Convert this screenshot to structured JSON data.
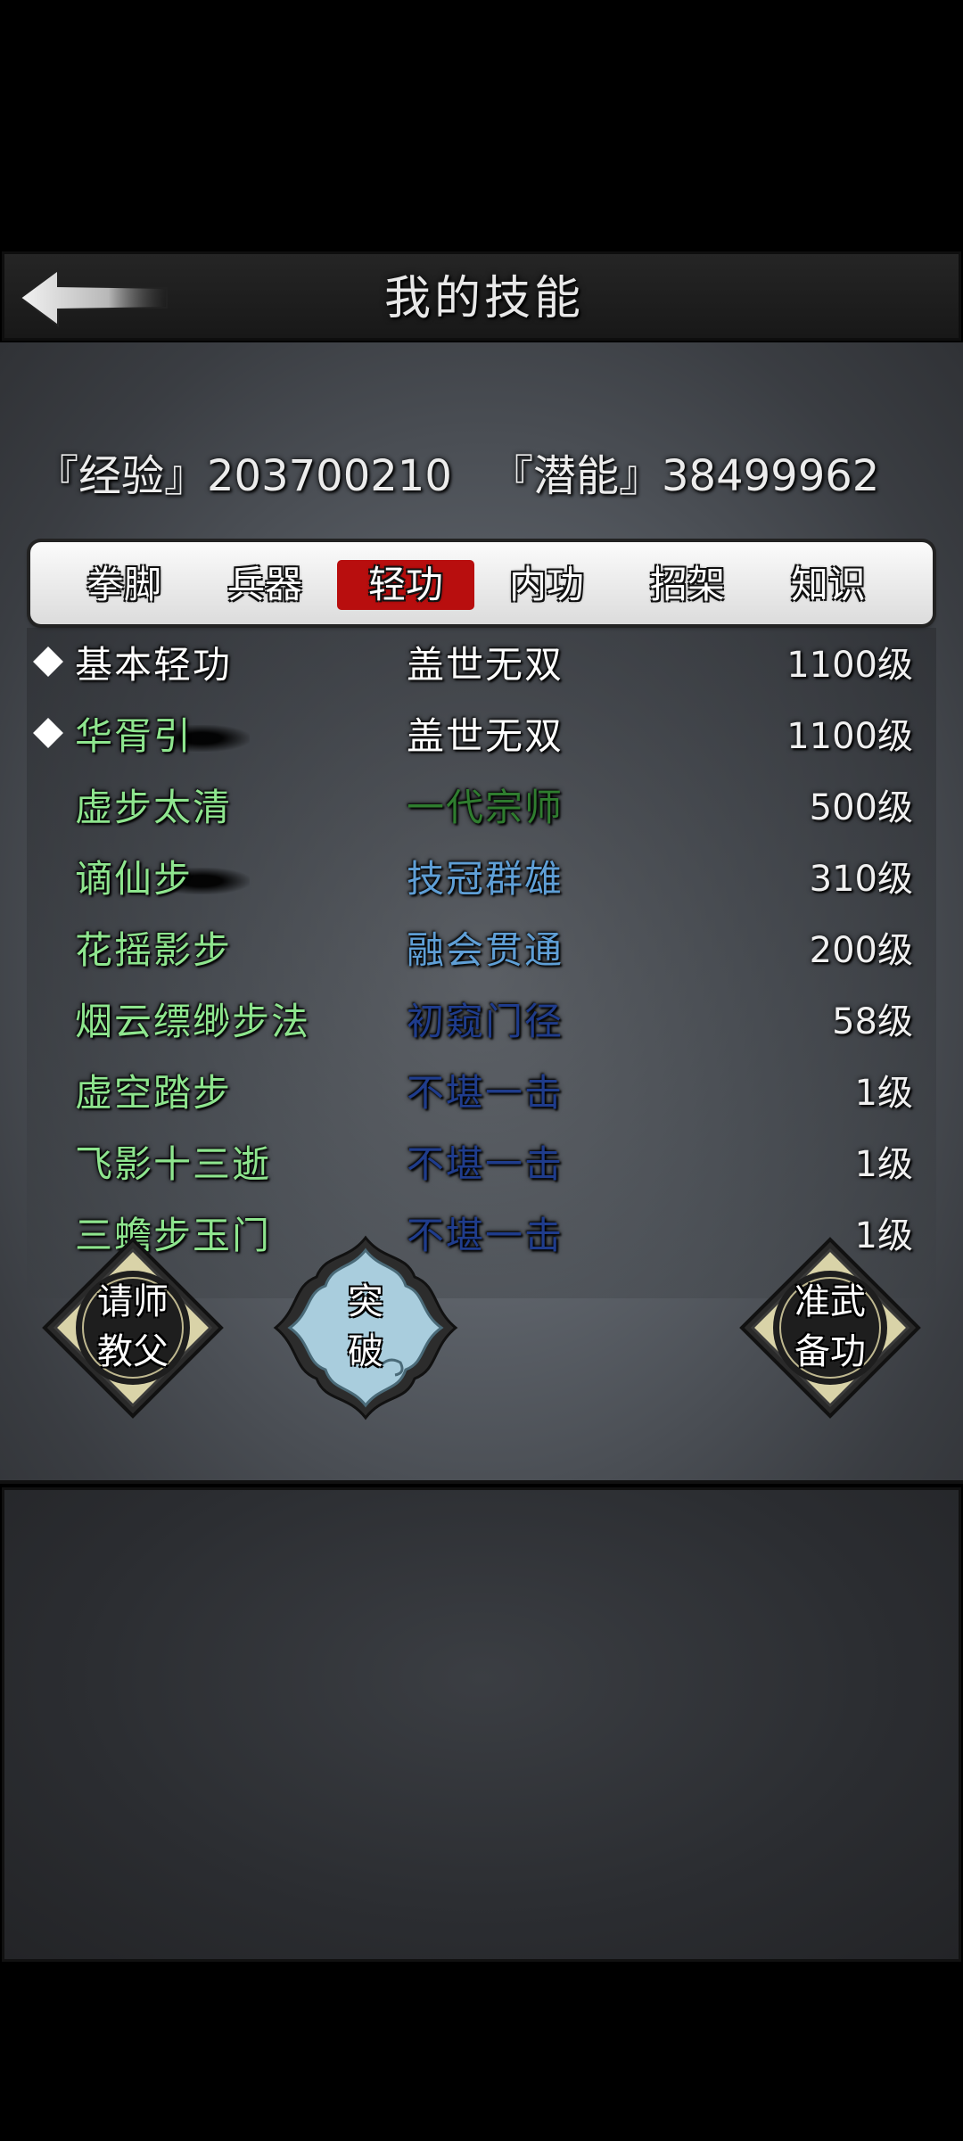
{
  "header": {
    "title": "我的技能"
  },
  "stats": {
    "exp_label": "『经验』",
    "exp_value": "203700210",
    "pot_label": "『潜能』",
    "pot_value": "38499962"
  },
  "tabs": [
    {
      "label": "拳脚",
      "active": false
    },
    {
      "label": "兵器",
      "active": false
    },
    {
      "label": "轻功",
      "active": true
    },
    {
      "label": "内功",
      "active": false
    },
    {
      "label": "招架",
      "active": false
    },
    {
      "label": "知识",
      "active": false
    }
  ],
  "skills": [
    {
      "name": "基本轻功",
      "rank": "盖世无双",
      "level": "1100级",
      "marked": true,
      "name_color": "#ffffff",
      "rank_color": "#ffffff"
    },
    {
      "name": "华胥引",
      "rank": "盖世无双",
      "level": "1100级",
      "marked": true,
      "name_color": "#8ee58e",
      "rank_color": "#ffffff"
    },
    {
      "name": "虚步太清",
      "rank": "一代宗师",
      "level": "500级",
      "marked": false,
      "name_color": "#8ee58e",
      "rank_color": "#2f7d2f"
    },
    {
      "name": "谪仙步",
      "rank": "技冠群雄",
      "level": "310级",
      "marked": false,
      "name_color": "#8ee58e",
      "rank_color": "#5f9fd6"
    },
    {
      "name": "花摇影步",
      "rank": "融会贯通",
      "level": "200级",
      "marked": false,
      "name_color": "#8ee58e",
      "rank_color": "#5f9fd6"
    },
    {
      "name": "烟云缥缈步法",
      "rank": "初窥门径",
      "level": "58级",
      "marked": false,
      "name_color": "#8ee58e",
      "rank_color": "#1f3c8c"
    },
    {
      "name": "虚空踏步",
      "rank": "不堪一击",
      "level": "1级",
      "marked": false,
      "name_color": "#8ee58e",
      "rank_color": "#1f3c8c"
    },
    {
      "name": "飞影十三逝",
      "rank": "不堪一击",
      "level": "1级",
      "marked": false,
      "name_color": "#8ee58e",
      "rank_color": "#1f3c8c"
    },
    {
      "name": "三蟾步玉门",
      "rank": "不堪一击",
      "level": "1级",
      "marked": false,
      "name_color": "#8ee58e",
      "rank_color": "#1f3c8c"
    }
  ],
  "buttons": {
    "teacher": [
      "请师",
      "教父"
    ],
    "breakthrough": [
      "突",
      "破"
    ],
    "prepare": [
      "准武",
      "备功"
    ]
  }
}
